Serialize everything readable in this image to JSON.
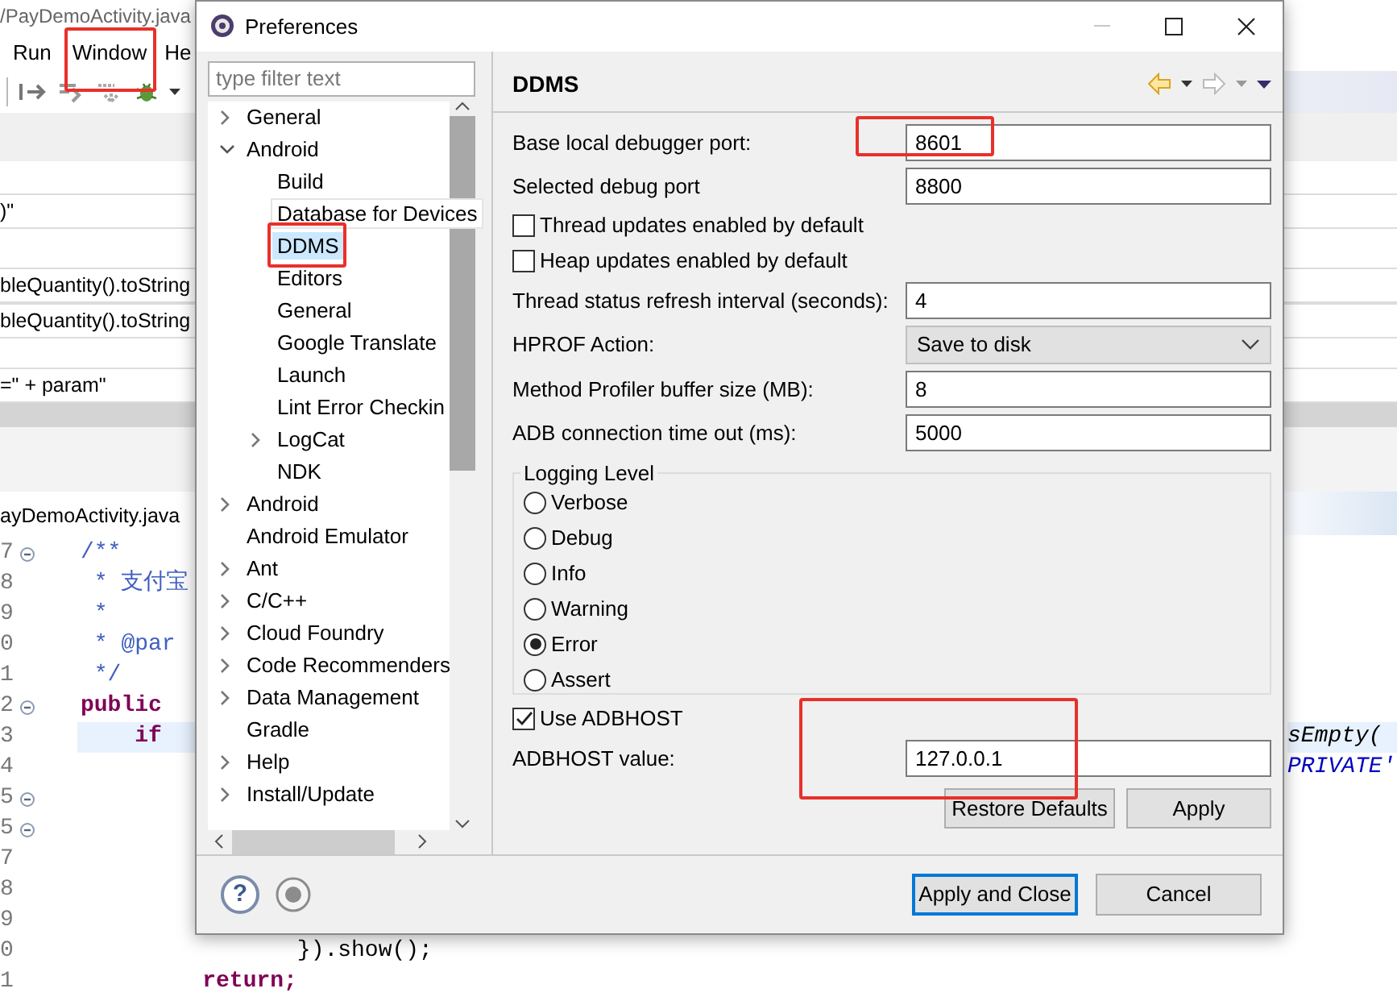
{
  "ide": {
    "title": "/PayDemoActivity.java",
    "menu": [
      {
        "label": "Run",
        "highlighted": false
      },
      {
        "label": "Window",
        "highlighted": true
      },
      {
        "label": "He",
        "highlighted": false
      }
    ],
    "list_rows": [
      ")\"",
      "bleQuantity().toString",
      "bleQuantity().toString",
      "=\" + param\""
    ],
    "editor_tab": "ayDemoActivity.java",
    "editor_lines": [
      {
        "number": "7",
        "fold": true,
        "current": false,
        "code": "/**",
        "kind": "comment"
      },
      {
        "number": "8",
        "fold": false,
        "current": false,
        "code": " * 支付宝",
        "kind": "comment"
      },
      {
        "number": "9",
        "fold": false,
        "current": false,
        "code": " *",
        "kind": "comment"
      },
      {
        "number": "0",
        "fold": false,
        "current": false,
        "code": " * @par",
        "kind": "comment"
      },
      {
        "number": "1",
        "fold": false,
        "current": false,
        "code": " */",
        "kind": "comment"
      },
      {
        "number": "2",
        "fold": true,
        "current": false,
        "code": "public",
        "kind": "keyword"
      },
      {
        "number": "3",
        "fold": false,
        "current": true,
        "code": "    if",
        "kind": "keyword",
        "right": {
          "text": "sEmpty(",
          "kind": "method"
        }
      },
      {
        "number": "4",
        "fold": false,
        "current": false,
        "right": {
          "text": "PRIVATE'",
          "kind": "constant"
        }
      },
      {
        "number": "5",
        "fold": true,
        "current": false
      },
      {
        "number": "5",
        "fold": true,
        "current": false
      },
      {
        "number": "7",
        "fold": false,
        "current": false
      },
      {
        "number": "8",
        "fold": false,
        "current": false
      },
      {
        "number": "9",
        "fold": false,
        "current": false
      },
      {
        "number": "0",
        "fold": false,
        "current": false,
        "code": "                }).show();",
        "kind": "plain"
      },
      {
        "number": "1",
        "fold": false,
        "current": false,
        "code": "         return;",
        "kind": "keyword"
      }
    ]
  },
  "dialog": {
    "title": "Preferences",
    "filter": {
      "placeholder": "type filter text"
    },
    "tree": [
      {
        "label": "General",
        "expanded": false,
        "selected": false
      },
      {
        "label": "Android",
        "expanded": true,
        "selected": false,
        "children": [
          {
            "label": "Build",
            "selected": false
          },
          {
            "label": "Database for Devices",
            "selected": false,
            "tooltip": true
          },
          {
            "label": "DDMS",
            "selected": true,
            "highlighted": true
          },
          {
            "label": "Editors",
            "selected": false
          },
          {
            "label": "General",
            "selected": false
          },
          {
            "label": "Google Translate",
            "selected": false
          },
          {
            "label": "Launch",
            "selected": false
          },
          {
            "label": "Lint Error Checkin",
            "selected": false
          },
          {
            "label": "LogCat",
            "expanded": false,
            "selected": false
          },
          {
            "label": "NDK",
            "selected": false
          }
        ]
      },
      {
        "label": "Android",
        "expanded": false,
        "selected": false
      },
      {
        "label": "Android Emulator",
        "selected": false
      },
      {
        "label": "Ant",
        "expanded": false,
        "selected": false
      },
      {
        "label": "C/C++",
        "expanded": false,
        "selected": false
      },
      {
        "label": "Cloud Foundry",
        "expanded": false,
        "selected": false
      },
      {
        "label": "Code Recommenders",
        "expanded": false,
        "selected": false
      },
      {
        "label": "Data Management",
        "expanded": false,
        "selected": false
      },
      {
        "label": "Gradle",
        "selected": false
      },
      {
        "label": "Help",
        "expanded": false,
        "selected": false
      },
      {
        "label": "Install/Update",
        "expanded": false,
        "selected": false
      }
    ],
    "page": {
      "title": "DDMS",
      "settings": [
        {
          "kind": "text",
          "label": "Base local debugger port:",
          "value": "8601",
          "highlighted": true
        },
        {
          "kind": "text",
          "label": "Selected debug port",
          "value": "8800",
          "highlighted": false
        },
        {
          "kind": "checkbox",
          "label": "Thread updates enabled by default",
          "checked": false
        },
        {
          "kind": "checkbox",
          "label": "Heap updates enabled by default",
          "checked": false
        },
        {
          "kind": "text",
          "label": "Thread status refresh interval (seconds):",
          "value": "4",
          "highlighted": false
        },
        {
          "kind": "dropdown",
          "label": "HPROF Action:",
          "value": "Save to disk"
        },
        {
          "kind": "text",
          "label": "Method Profiler buffer size (MB):",
          "value": "8",
          "highlighted": false
        },
        {
          "kind": "text",
          "label": "ADB connection time out (ms):",
          "value": "5000",
          "highlighted": false
        }
      ],
      "logging": {
        "title": "Logging Level",
        "options": [
          {
            "label": "Verbose",
            "selected": false
          },
          {
            "label": "Debug",
            "selected": false
          },
          {
            "label": "Info",
            "selected": false
          },
          {
            "label": "Warning",
            "selected": false
          },
          {
            "label": "Error",
            "selected": true
          },
          {
            "label": "Assert",
            "selected": false
          }
        ]
      },
      "more_settings": [
        {
          "kind": "checkbox",
          "label": "Use ADBHOST",
          "checked": true
        },
        {
          "kind": "text",
          "label": "ADBHOST value:",
          "value": "127.0.0.1",
          "highlighted": true
        }
      ],
      "buttons": [
        "Restore Defaults",
        "Apply"
      ]
    },
    "help_icon": "?",
    "buttons": [
      {
        "label": "Apply and Close",
        "default": true
      },
      {
        "label": "Cancel",
        "default": false
      }
    ]
  }
}
